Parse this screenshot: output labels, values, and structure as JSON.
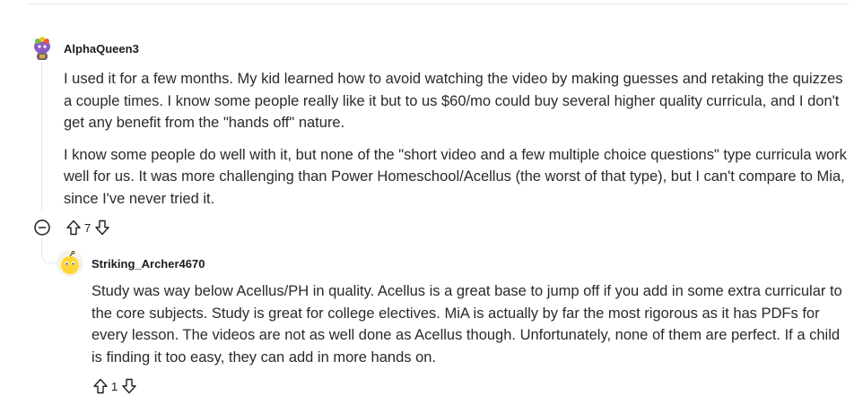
{
  "comments": [
    {
      "username": "AlphaQueen3",
      "paragraphs": [
        "I used it for a few months. My kid learned how to avoid watching the video by making guesses and retaking the quizzes a couple times. I know some people really like it but to us $60/mo could buy several higher quality curricula, and I don't get any benefit from the \"hands off\" nature.",
        "I know some people do well with it, but none of the \"short video and a few multiple choice questions\" type curricula work well for us. It was more challenging than Power Homeschool/Acellus (the worst of that type), but I can't compare to Mia, since I've never tried it."
      ],
      "votes": "7"
    },
    {
      "username": "Striking_Archer4670",
      "paragraphs": [
        "Study was way below Acellus/PH in quality. Acellus is a great base to jump off if you add in some extra curricular to the core subjects. Study is great for college electives. MiA is actually by far the most rigorous as it has PDFs for every lesson. The videos are not as well done as Acellus though. Unfortunately, none of them are perfect.  If a child is finding it too easy, they can add in more hands on."
      ],
      "votes": "1"
    }
  ],
  "icons": {
    "upvote": "arrow-up-outline-icon",
    "downvote": "arrow-down-outline-icon",
    "collapse": "minus-circle-icon"
  }
}
